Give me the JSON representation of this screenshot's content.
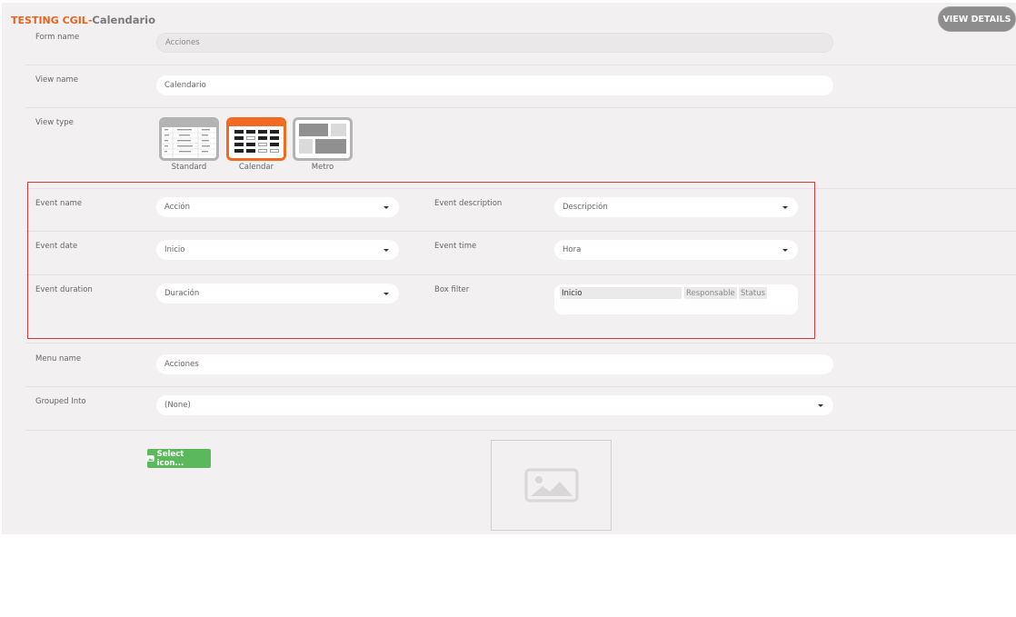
{
  "header": {
    "app_name": "TESTING CGIL",
    "separator": "-",
    "view_name": "Calendario",
    "view_details_label": "VIEW DETAILS"
  },
  "form": {
    "form_name": {
      "label": "Form name",
      "value": "Acciones"
    },
    "view_name": {
      "label": "View name",
      "value": "Calendario"
    },
    "view_type": {
      "label": "View type",
      "options": [
        {
          "label": "Standard",
          "selected": false
        },
        {
          "label": "Calendar",
          "selected": true
        },
        {
          "label": "Metro",
          "selected": false
        }
      ]
    },
    "event_name": {
      "label": "Event name",
      "value": "Acción"
    },
    "event_description": {
      "label": "Event description",
      "value": "Descripción"
    },
    "event_date": {
      "label": "Event date",
      "value": "Inicio"
    },
    "event_time": {
      "label": "Event time",
      "value": "Hora"
    },
    "event_duration": {
      "label": "Event duration",
      "value": "Duración"
    },
    "box_filter": {
      "label": "Box filter",
      "chips": [
        "Inicio",
        "Responsable",
        "Status"
      ]
    },
    "menu_name": {
      "label": "Menu name",
      "value": "Acciones"
    },
    "grouped_into": {
      "label": "Grouped Into",
      "value": "(None)"
    },
    "select_icon_label": "Select icon..."
  },
  "colors": {
    "accent": "#e9631f",
    "selected_border": "#f26a21",
    "highlight_box": "#d43a3a",
    "select_icon_button": "#5cb85c"
  },
  "icons": [
    "calendar-icon",
    "image-placeholder-icon",
    "dropdown-caret-icon"
  ]
}
